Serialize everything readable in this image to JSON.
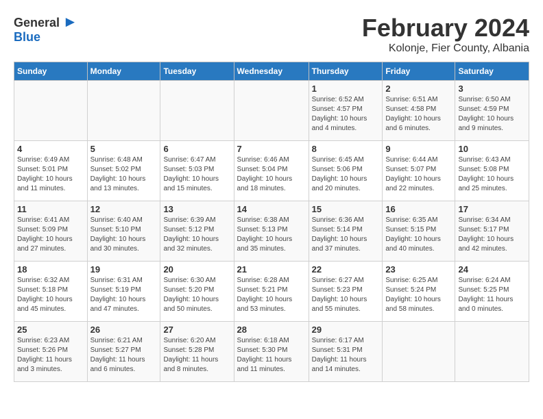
{
  "header": {
    "logo_general": "General",
    "logo_blue": "Blue",
    "title": "February 2024",
    "location": "Kolonje, Fier County, Albania"
  },
  "calendar": {
    "days_of_week": [
      "Sunday",
      "Monday",
      "Tuesday",
      "Wednesday",
      "Thursday",
      "Friday",
      "Saturday"
    ],
    "weeks": [
      [
        {
          "day": "",
          "info": ""
        },
        {
          "day": "",
          "info": ""
        },
        {
          "day": "",
          "info": ""
        },
        {
          "day": "",
          "info": ""
        },
        {
          "day": "1",
          "info": "Sunrise: 6:52 AM\nSunset: 4:57 PM\nDaylight: 10 hours\nand 4 minutes."
        },
        {
          "day": "2",
          "info": "Sunrise: 6:51 AM\nSunset: 4:58 PM\nDaylight: 10 hours\nand 6 minutes."
        },
        {
          "day": "3",
          "info": "Sunrise: 6:50 AM\nSunset: 4:59 PM\nDaylight: 10 hours\nand 9 minutes."
        }
      ],
      [
        {
          "day": "4",
          "info": "Sunrise: 6:49 AM\nSunset: 5:01 PM\nDaylight: 10 hours\nand 11 minutes."
        },
        {
          "day": "5",
          "info": "Sunrise: 6:48 AM\nSunset: 5:02 PM\nDaylight: 10 hours\nand 13 minutes."
        },
        {
          "day": "6",
          "info": "Sunrise: 6:47 AM\nSunset: 5:03 PM\nDaylight: 10 hours\nand 15 minutes."
        },
        {
          "day": "7",
          "info": "Sunrise: 6:46 AM\nSunset: 5:04 PM\nDaylight: 10 hours\nand 18 minutes."
        },
        {
          "day": "8",
          "info": "Sunrise: 6:45 AM\nSunset: 5:06 PM\nDaylight: 10 hours\nand 20 minutes."
        },
        {
          "day": "9",
          "info": "Sunrise: 6:44 AM\nSunset: 5:07 PM\nDaylight: 10 hours\nand 22 minutes."
        },
        {
          "day": "10",
          "info": "Sunrise: 6:43 AM\nSunset: 5:08 PM\nDaylight: 10 hours\nand 25 minutes."
        }
      ],
      [
        {
          "day": "11",
          "info": "Sunrise: 6:41 AM\nSunset: 5:09 PM\nDaylight: 10 hours\nand 27 minutes."
        },
        {
          "day": "12",
          "info": "Sunrise: 6:40 AM\nSunset: 5:10 PM\nDaylight: 10 hours\nand 30 minutes."
        },
        {
          "day": "13",
          "info": "Sunrise: 6:39 AM\nSunset: 5:12 PM\nDaylight: 10 hours\nand 32 minutes."
        },
        {
          "day": "14",
          "info": "Sunrise: 6:38 AM\nSunset: 5:13 PM\nDaylight: 10 hours\nand 35 minutes."
        },
        {
          "day": "15",
          "info": "Sunrise: 6:36 AM\nSunset: 5:14 PM\nDaylight: 10 hours\nand 37 minutes."
        },
        {
          "day": "16",
          "info": "Sunrise: 6:35 AM\nSunset: 5:15 PM\nDaylight: 10 hours\nand 40 minutes."
        },
        {
          "day": "17",
          "info": "Sunrise: 6:34 AM\nSunset: 5:17 PM\nDaylight: 10 hours\nand 42 minutes."
        }
      ],
      [
        {
          "day": "18",
          "info": "Sunrise: 6:32 AM\nSunset: 5:18 PM\nDaylight: 10 hours\nand 45 minutes."
        },
        {
          "day": "19",
          "info": "Sunrise: 6:31 AM\nSunset: 5:19 PM\nDaylight: 10 hours\nand 47 minutes."
        },
        {
          "day": "20",
          "info": "Sunrise: 6:30 AM\nSunset: 5:20 PM\nDaylight: 10 hours\nand 50 minutes."
        },
        {
          "day": "21",
          "info": "Sunrise: 6:28 AM\nSunset: 5:21 PM\nDaylight: 10 hours\nand 53 minutes."
        },
        {
          "day": "22",
          "info": "Sunrise: 6:27 AM\nSunset: 5:23 PM\nDaylight: 10 hours\nand 55 minutes."
        },
        {
          "day": "23",
          "info": "Sunrise: 6:25 AM\nSunset: 5:24 PM\nDaylight: 10 hours\nand 58 minutes."
        },
        {
          "day": "24",
          "info": "Sunrise: 6:24 AM\nSunset: 5:25 PM\nDaylight: 11 hours\nand 0 minutes."
        }
      ],
      [
        {
          "day": "25",
          "info": "Sunrise: 6:23 AM\nSunset: 5:26 PM\nDaylight: 11 hours\nand 3 minutes."
        },
        {
          "day": "26",
          "info": "Sunrise: 6:21 AM\nSunset: 5:27 PM\nDaylight: 11 hours\nand 6 minutes."
        },
        {
          "day": "27",
          "info": "Sunrise: 6:20 AM\nSunset: 5:28 PM\nDaylight: 11 hours\nand 8 minutes."
        },
        {
          "day": "28",
          "info": "Sunrise: 6:18 AM\nSunset: 5:30 PM\nDaylight: 11 hours\nand 11 minutes."
        },
        {
          "day": "29",
          "info": "Sunrise: 6:17 AM\nSunset: 5:31 PM\nDaylight: 11 hours\nand 14 minutes."
        },
        {
          "day": "",
          "info": ""
        },
        {
          "day": "",
          "info": ""
        }
      ]
    ]
  }
}
